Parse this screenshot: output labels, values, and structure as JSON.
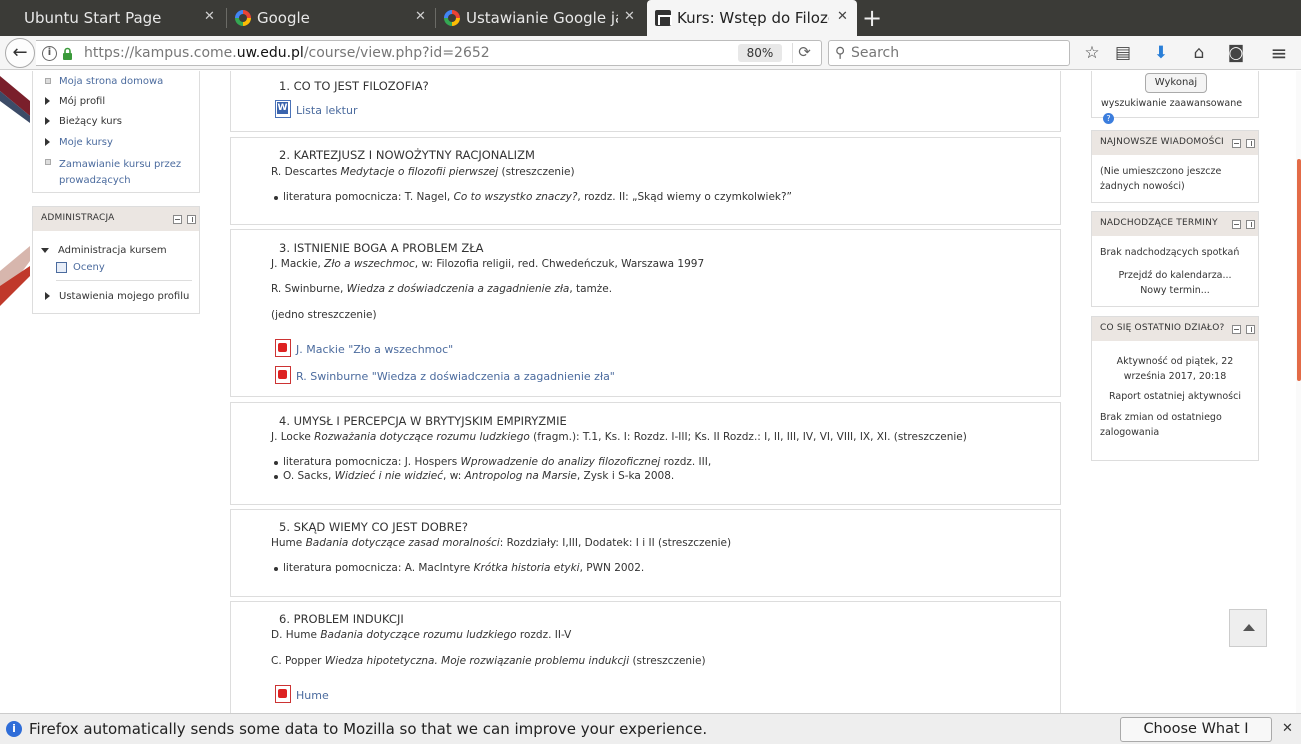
{
  "browser": {
    "tabs": [
      {
        "title": "Ubuntu Start Page"
      },
      {
        "title": "Google"
      },
      {
        "title": "Ustawianie Google jak"
      },
      {
        "title": "Kurs: Wstęp do Filozof"
      }
    ],
    "tab_close_glyph": "✕",
    "new_tab_glyph": "+",
    "url_prefix": "https://kampus.come.",
    "url_domain": "uw.edu.pl",
    "url_path": "/course/view.php?id=2652",
    "zoom": "80%",
    "search_placeholder": "Search",
    "icons": {
      "back": "←",
      "info": "i",
      "reload": "⟳",
      "search": "⚲",
      "bookmark_star": "☆",
      "reading_list": "▤",
      "downloads": "⬇",
      "home": "⌂",
      "pocket": "◙",
      "menu": "≡"
    }
  },
  "left": {
    "nav_items": [
      {
        "label": "Moja strona domowa",
        "link": true,
        "marker": "bullet"
      },
      {
        "label": "Mój profil",
        "link": false,
        "marker": "tri"
      },
      {
        "label": "Bieżący kurs",
        "link": false,
        "marker": "tri"
      },
      {
        "label": "Moje kursy",
        "link": true,
        "marker": "tri"
      },
      {
        "label": "Zamawianie kursu przez",
        "label2": "prowadzących",
        "link": true,
        "marker": "bullet"
      }
    ],
    "admin": {
      "title": "ADMINISTRACJA",
      "course_admin": "Administracja kursem",
      "grades": "Oceny",
      "profile_settings": "Ustawienia mojego profilu"
    }
  },
  "sections": [
    {
      "title": "1. CO TO JEST FILOZOFIA?",
      "resources": [
        {
          "type": "word",
          "label": "Lista lektur"
        }
      ]
    },
    {
      "title": "2. KARTEZJUSZ I NOWOŻYTNY RACJONALIZM",
      "line1_a": "R. Descartes ",
      "line1_i": "Medytacje o filozofii pierwszej",
      "line1_b": " (streszczenie)",
      "bullet1_a": "literatura pomocnicza: T. Nagel, ",
      "bullet1_i": "Co to wszystko znaczy?",
      "bullet1_b": ", rozdz. II: „Skąd wiemy o czymkolwiek?”"
    },
    {
      "title": "3. ISTNIENIE BOGA A PROBLEM ZŁA",
      "line1_a": "J. Mackie, ",
      "line1_i": "Zło a wszechmoc",
      "line1_b": ", w: Filozofia religii, red. Chwedeńczuk, Warszawa 1997",
      "line2_a": "R. Swinburne, ",
      "line2_i": "Wiedza z doświadczenia a zagadnienie zła",
      "line2_b": ", tamże.",
      "line3": "(jedno streszczenie)",
      "resources": [
        {
          "type": "pdf",
          "label": "J. Mackie \"Zło a wszechmoc\""
        },
        {
          "type": "pdf",
          "label": "R. Swinburne \"Wiedza z doświadczenia a zagadnienie zła\""
        }
      ]
    },
    {
      "title": "4. UMYSŁ I PERCEPCJA W BRYTYJSKIM EMPIRYZMIE",
      "line1_a": "J. Locke ",
      "line1_i": "Rozważania dotyczące rozumu ludzkiego",
      "line1_b": " (fragm.): T.1, Ks. I: Rozdz. I-III; Ks. II Rozdz.: I, II, III, IV, VI, VIII, IX, XI. (streszczenie)",
      "bullet1_a": "literatura pomocnicza: J. Hospers ",
      "bullet1_i": "Wprowadzenie do analizy filozoficznej",
      "bullet1_b": " rozdz. III,",
      "bullet2_a": "O. Sacks, ",
      "bullet2_i": "Widzieć i nie widzieć",
      "bullet2_b": ", w: ",
      "bullet2_i2": "Antropolog na Marsie",
      "bullet2_c": ", Zysk i S-ka 2008."
    },
    {
      "title": "5. SKĄD WIEMY CO JEST DOBRE?",
      "line1_a": "Hume ",
      "line1_i": "Badania dotyczące zasad moralności",
      "line1_b": ": Rozdziały: I,III, Dodatek: I i II (streszczenie)",
      "bullet1_a": "literatura pomocnicza: A. MacIntyre ",
      "bullet1_i": "Krótka historia etyki",
      "bullet1_b": ", PWN 2002."
    },
    {
      "title": "6. PROBLEM INDUKCJI",
      "line1_a": "D. Hume ",
      "line1_i": "Badania dotyczące rozumu ludzkiego",
      "line1_b": " rozdz. II-V",
      "line2_a": "C. Popper ",
      "line2_i": "Wiedza hipotetyczna. Moje rozwiązanie problemu indukcji",
      "line2_b": " (streszczenie)",
      "resources": [
        {
          "type": "pdf",
          "label": "Hume"
        }
      ]
    }
  ],
  "right": {
    "search_button": "Wykonaj",
    "advanced_search": "wyszukiwanie zaawansowane",
    "help_glyph": "?",
    "news": {
      "title": "NAJNOWSZE WIADOMOŚCI",
      "line1": "(Nie umieszczono jeszcze",
      "line2": "żadnych nowości)"
    },
    "events": {
      "title": "NADCHODZĄCE TERMINY",
      "none": "Brak nadchodzących spotkań",
      "calendar": "Przejdź do kalendarza...",
      "new_event": "Nowy termin..."
    },
    "recent": {
      "title": "CO SIĘ OSTATNIO DZIAŁO?",
      "since1": "Aktywność od piątek, 22",
      "since2": "września 2017, 20:18",
      "report": "Raport ostatniej aktywności",
      "none1": "Brak zmian od ostatniego",
      "none2": "zalogowania"
    }
  },
  "notification": {
    "icon": "i",
    "text": "Firefox automatically sends some data to Mozilla so that we can improve your experience.",
    "button": "Choose What I Share",
    "close": "✕"
  }
}
